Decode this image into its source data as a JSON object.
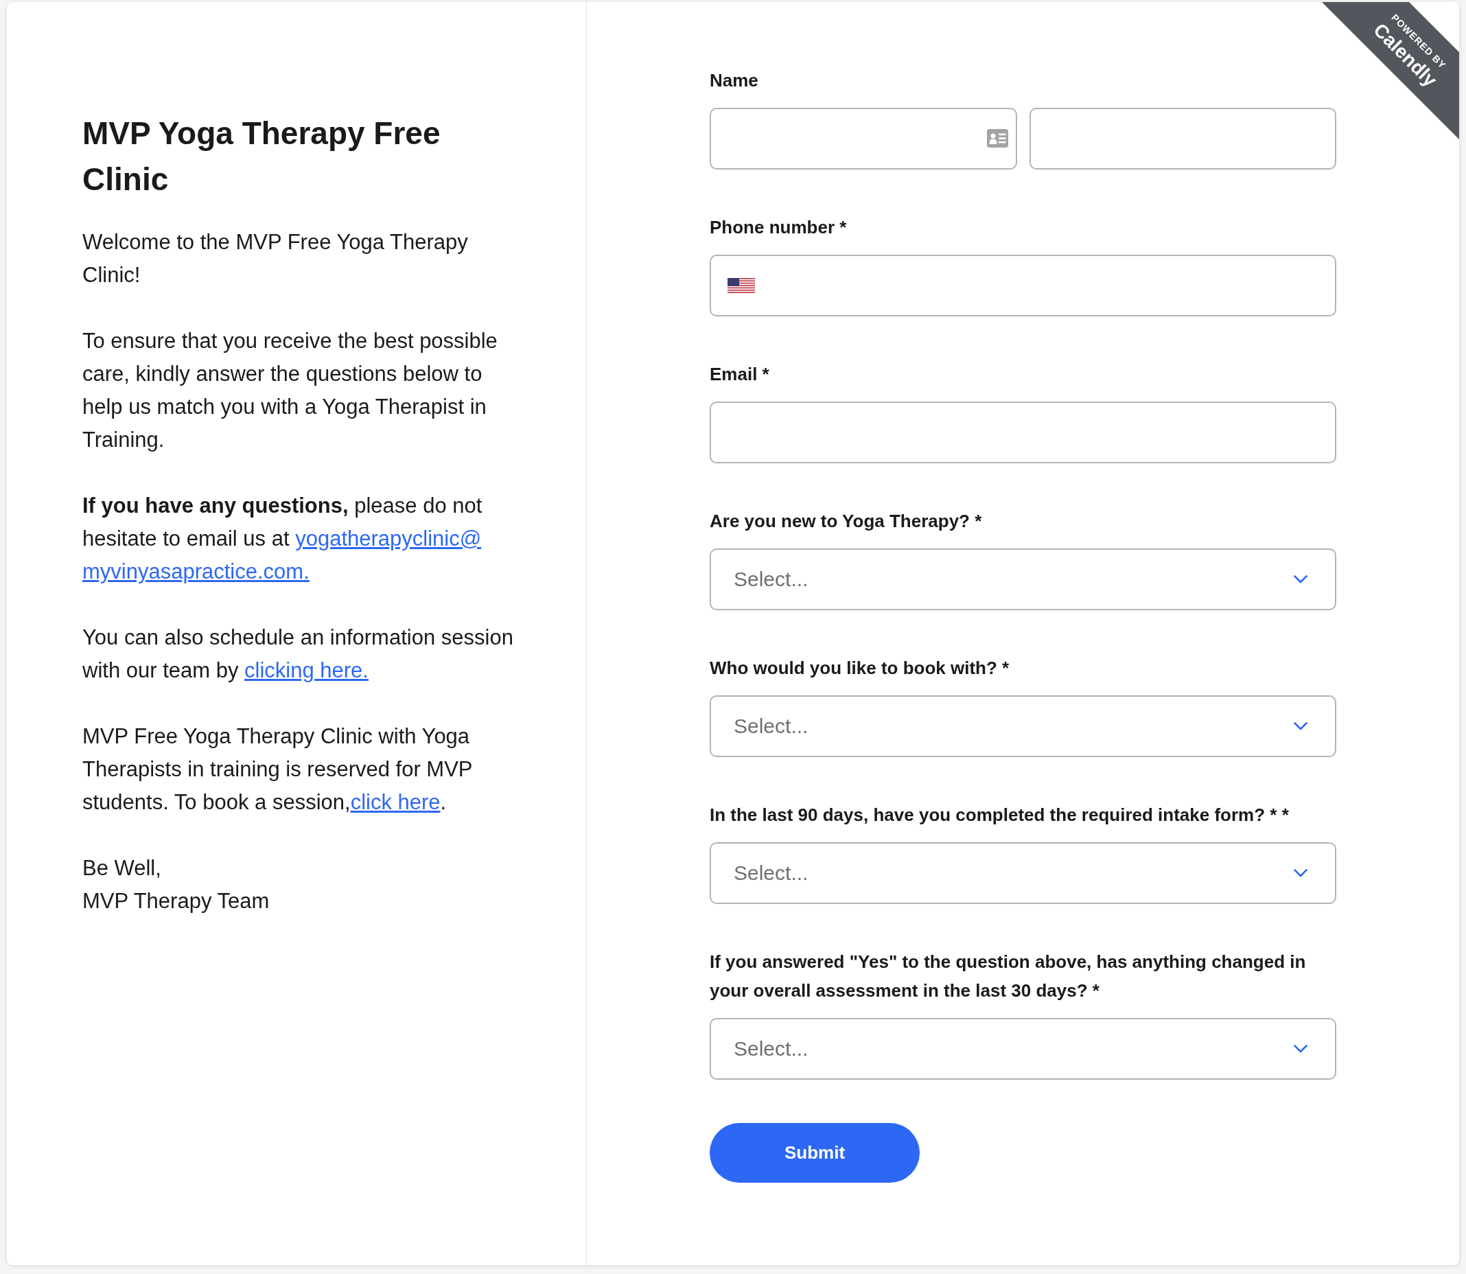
{
  "intro": {
    "title": "MVP Yoga Therapy Free Clinic",
    "paragraphs": [
      {
        "segments": [
          {
            "kind": "text",
            "text": "Welcome to the MVP Free Yoga Therapy Clinic!"
          }
        ]
      },
      {
        "segments": [
          {
            "kind": "text",
            "text": "To ensure that you receive the best possible care, kindly answer the questions below to help us match you with a Yoga Therapist in Training."
          }
        ]
      },
      {
        "segments": [
          {
            "kind": "text",
            "text": "**If you have any questions,** please do not hesitate to email us at "
          },
          {
            "kind": "link",
            "text": "yogatherapyclinic@"
          },
          {
            "kind": "link",
            "text": "myvinyasapractice.com."
          }
        ]
      },
      {
        "segments": [
          {
            "kind": "text",
            "text": "You can also schedule an information session with our team by "
          },
          {
            "kind": "link",
            "text": "clicking here."
          }
        ]
      },
      {
        "segments": [
          {
            "kind": "text",
            "text": "MVP Free Yoga Therapy Clinic with Yoga Therapists in training is reserved for MVP students. To book a session,"
          },
          {
            "kind": "link",
            "text": "click here"
          },
          {
            "kind": "text",
            "text": "."
          }
        ]
      }
    ],
    "sign_off": [
      "Be Well,",
      "MVP Therapy Team"
    ]
  },
  "form": {
    "fields": [
      {
        "kind": "name",
        "label": "Name"
      },
      {
        "kind": "phone",
        "label": "Phone number *"
      },
      {
        "kind": "email",
        "label": "Email *"
      },
      {
        "kind": "select",
        "label": "Are you new to Yoga Therapy? *",
        "placeholder": "Select..."
      },
      {
        "kind": "select",
        "label": "Who would you like to book with? *",
        "placeholder": "Select..."
      },
      {
        "kind": "select",
        "label": "In the last 90 days, have you completed the required intake form? * *",
        "placeholder": "Select..."
      },
      {
        "kind": "select",
        "label": "If you answered \"Yes\" to the question above, has anything changed in your overall assessment in the last 30 days? *",
        "placeholder": "Select..."
      }
    ],
    "submit": "Submit"
  },
  "badge": {
    "caption": "POWERED BY",
    "brand": "Calendly"
  }
}
